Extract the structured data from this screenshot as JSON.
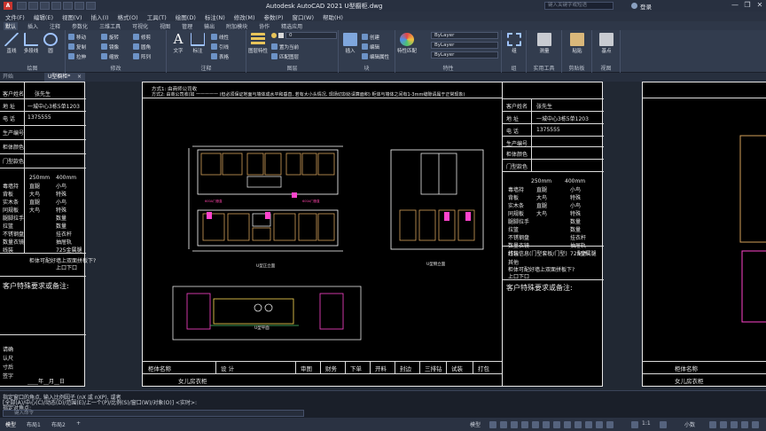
{
  "titlebar": {
    "logo_text": "A",
    "title": "Autodesk AutoCAD 2021    U型橱柜.dwg",
    "search_placeholder": "键入关键字或短语",
    "user": "登录",
    "minimize": "—",
    "restore": "❐",
    "close": "✕"
  },
  "menubar": [
    "文件(F)",
    "编辑(E)",
    "视图(V)",
    "插入(I)",
    "格式(O)",
    "工具(T)",
    "绘图(D)",
    "标注(N)",
    "修改(M)",
    "参数(P)",
    "窗口(W)",
    "帮助(H)"
  ],
  "ribbon_tabs": [
    "默认",
    "插入",
    "注释",
    "参数化",
    "三维工具",
    "可视化",
    "视图",
    "管理",
    "输出",
    "附加模块",
    "协作",
    "精选应用"
  ],
  "ribbon": {
    "draw": {
      "label": "绘图",
      "tools": [
        "直线",
        "多段线",
        "圆",
        "圆弧"
      ]
    },
    "modify": {
      "label": "修改",
      "tools": [
        "移动",
        "旋转",
        "修剪",
        "复制",
        "镜像",
        "圆角",
        "拉伸",
        "缩放",
        "阵列"
      ]
    },
    "annotation": {
      "label": "注释",
      "tools": [
        "文字",
        "标注"
      ],
      "small": [
        "线性",
        "引线",
        "表格"
      ]
    },
    "layers": {
      "label": "图层",
      "big": "图层特性",
      "current_layer": "0",
      "small": [
        "置为当前",
        "匹配图层"
      ]
    },
    "block": {
      "label": "块",
      "big": "插入",
      "small": [
        "创建",
        "编辑",
        "编辑属性"
      ]
    },
    "properties": {
      "label": "特性",
      "big": "特性匹配",
      "combos": [
        "ByLayer",
        "ByLayer",
        "ByLayer"
      ]
    },
    "groups": {
      "label": "组",
      "big": "组"
    },
    "utilities": {
      "label": "实用工具",
      "big": "测量"
    },
    "clipboard": {
      "label": "剪贴板",
      "big": "粘贴"
    },
    "view": {
      "label": "视图",
      "big": "基点"
    }
  },
  "doc_tabs": {
    "start": "开始",
    "active": "U型橱柜*",
    "close": "×"
  },
  "drawing": {
    "notes": [
      "方式1: 由商师公司收",
      "方式2: 由商公司收(如 一一一一一 (但必须保证地面与墙体成水平和垂直, 若有大小头情况, 现场切割处请算面积) 柜体与墙体之间有1-3mm缝隙请属于正常现象)"
    ],
    "left_labels": [
      "客户姓名",
      "地  址",
      "电  话",
      "生产编号",
      "柜体颜色",
      "门型款色"
    ],
    "customer": "张先生",
    "address": "一城中心3栋5单1203",
    "phone": "1375555",
    "specs": [
      "250mm",
      "400mm"
    ],
    "mat_rows": [
      [
        "毒墙持",
        "直腿",
        "小鸟"
      ],
      [
        "背板",
        "大鸟",
        "特殊"
      ],
      [
        "实木条",
        "直腿",
        "小鸟"
      ],
      [
        "同规板",
        "大鸟",
        "特殊"
      ],
      [
        "腿脚拉手",
        "",
        "数量"
      ],
      [
        "拉篮",
        "",
        "数量"
      ],
      [
        "不锈钢盘",
        "",
        "挂衣杆"
      ],
      [
        "数量衣镜",
        "",
        "抽屉轨"
      ],
      [
        "线装",
        "",
        "725金属腿"
      ]
    ],
    "extra_rows": [
      "打包信息(门型套板/门型)",
      "配件",
      "其他"
    ],
    "cut_label": "柜体可配好墙上双面拼板下?",
    "cut_value": "上口下口",
    "special_label": "客户特殊要求或备注:",
    "view_labels": [
      "U型正立面",
      "U型侧立面",
      "U型平面"
    ],
    "footer_cells": [
      "柜体名称",
      "设  计",
      "审图",
      "财务",
      "下单",
      "开料",
      "封边",
      "三排钻",
      "试装",
      "打包"
    ],
    "footer_name": "女儿房衣柜",
    "confirm_text": [
      "请确",
      "认尺",
      "寸后",
      "签字"
    ],
    "date_text": "____年__月__日",
    "side_sheet": [
      "客户姓名",
      "地址",
      "电话",
      "生产编号",
      "柜体颜色",
      "门型款色"
    ]
  },
  "command": {
    "lines": [
      "指定窗口的角点, 输入比例因子 (nX 或 nXP), 或者",
      "[全部(A)/中心(C)/动态(D)/范围(E)/上一个(P)/比例(S)/窗口(W)/对象(O)] <实时>:",
      "指定对角点:"
    ],
    "placeholder": "键入命令"
  },
  "status": {
    "tabs": [
      "模型",
      "布局1",
      "布局2"
    ],
    "add": "+",
    "model_label": "模型",
    "scale": "1:1",
    "decimal": "小数"
  }
}
